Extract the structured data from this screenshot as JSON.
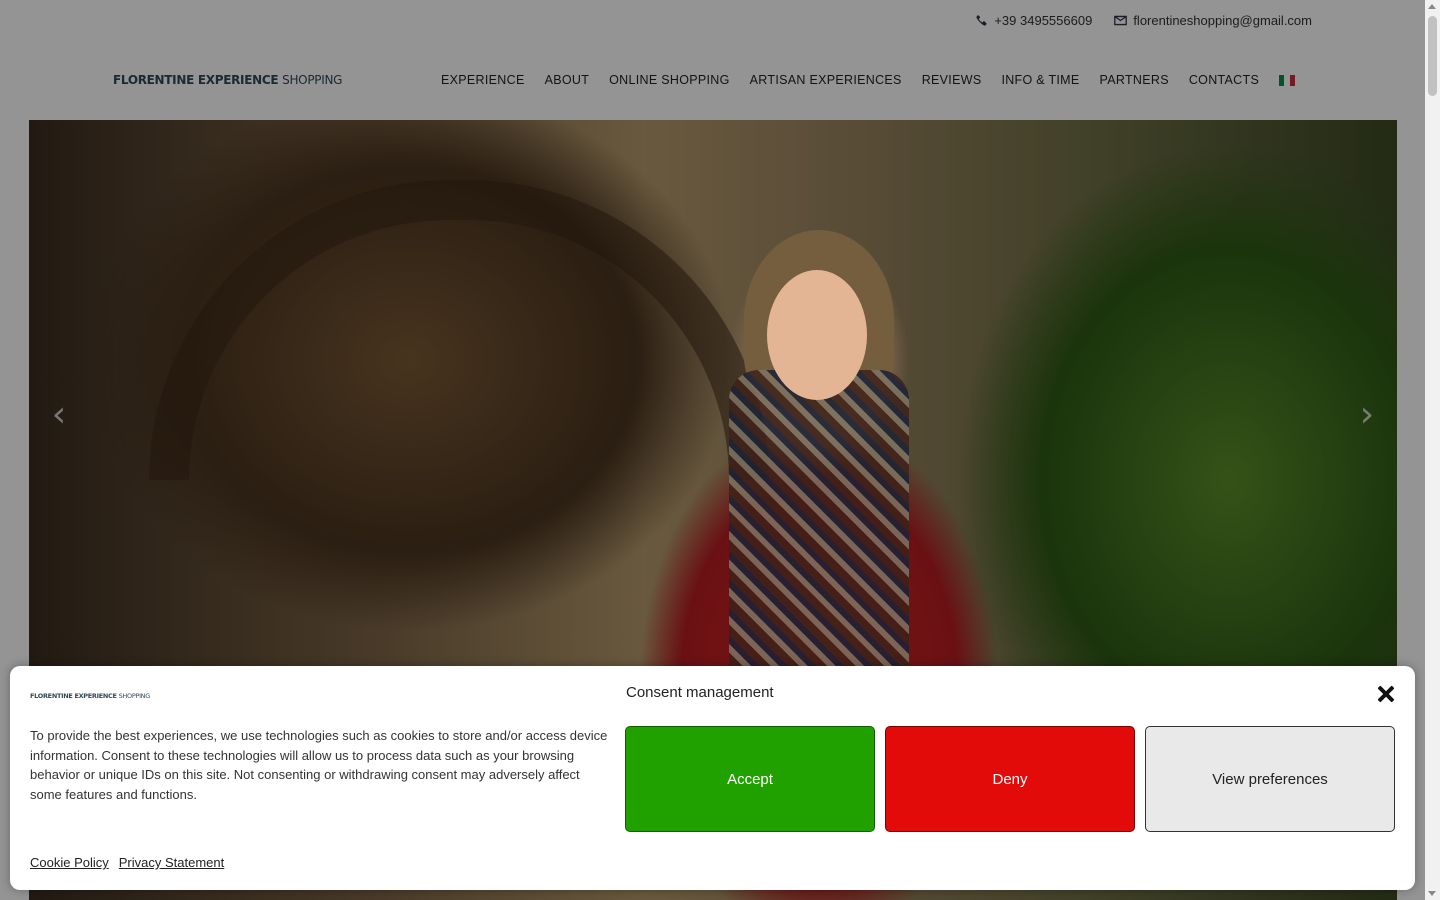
{
  "topbar": {
    "phone": "+39 3495556609",
    "email": "florentineshopping@gmail.com"
  },
  "logo": {
    "bold": "FLORENTINE EXPERIENCE ",
    "light": "SHOPPING"
  },
  "nav": {
    "items": [
      "EXPERIENCE",
      "ABOUT",
      "ONLINE SHOPPING",
      "ARTISAN EXPERIENCES",
      "REVIEWS",
      "INFO & TIME",
      "PARTNERS",
      "CONTACTS"
    ],
    "flag_colors": [
      "#009246",
      "#ffffff",
      "#ce2b37"
    ]
  },
  "hero": {
    "prev_arrow": "‹",
    "next_arrow": "›"
  },
  "consent": {
    "title": "Consent management",
    "description": "To provide the best experiences, we use technologies such as cookies to store and/or access device information. Consent to these technologies will allow us to process data such as your browsing behavior or unique IDs on this site. Not consenting or withdrawing consent may adversely affect some features and functions.",
    "accept_label": "Accept",
    "deny_label": "Deny",
    "preferences_label": "View preferences",
    "cookie_policy_label": "Cookie Policy",
    "privacy_label": "Privacy Statement",
    "accept_color": "#21a100",
    "deny_color": "#e30a0a"
  }
}
